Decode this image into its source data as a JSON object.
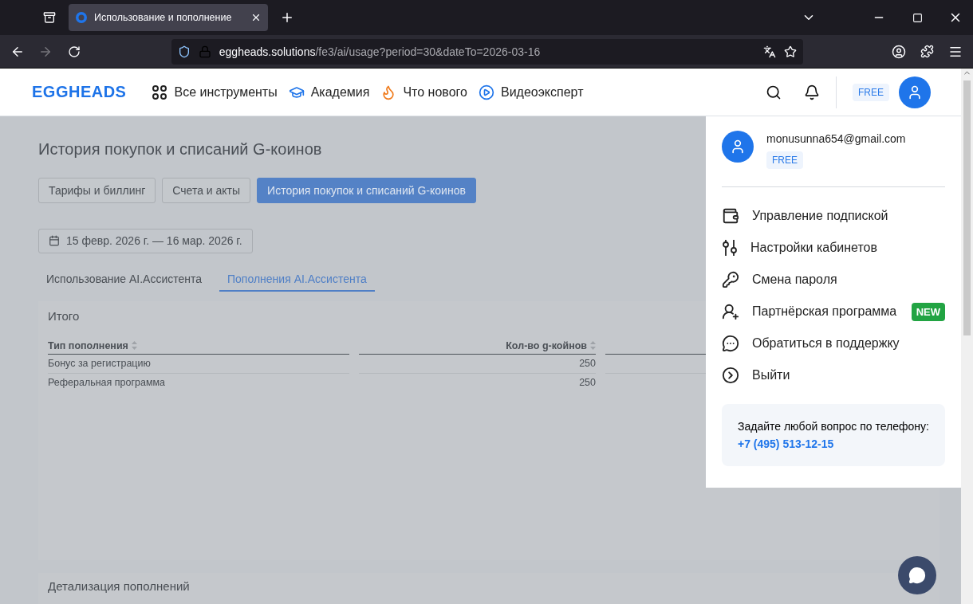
{
  "browser": {
    "tab_title": "Использование и пополнение",
    "url_host": "eggheads.solutions",
    "url_path": "/fe3/ai/usage?period=30&dateTo=2026-03-16"
  },
  "header": {
    "logo": "EGGHEADS",
    "nav": [
      {
        "label": "Все инструменты"
      },
      {
        "label": "Академия"
      },
      {
        "label": "Что нового"
      },
      {
        "label": "Видеоэксперт"
      }
    ],
    "plan_badge": "FREE"
  },
  "page": {
    "title": "История покупок и списаний G-коинов",
    "section_tabs": [
      {
        "label": "Тарифы и биллинг",
        "selected": false
      },
      {
        "label": "Счета и акты",
        "selected": false
      },
      {
        "label": "История покупок и списаний G-коинов",
        "selected": true
      }
    ],
    "date_range": "15 февр. 2026 г. — 16 мар. 2026 г.",
    "subtabs": [
      {
        "label": "Использование AI.Ассистента",
        "selected": false
      },
      {
        "label": "Пополнения AI.Ассистента",
        "selected": true
      }
    ],
    "summary": {
      "title": "Итого",
      "columns": [
        {
          "label": "Тип пополнения"
        },
        {
          "label": "Кол-во g-койнов"
        }
      ],
      "rows": [
        [
          "Бонус за регистрацию",
          "250"
        ],
        [
          "Реферальная программа",
          "250"
        ]
      ]
    },
    "details_title": "Детализация пополнений"
  },
  "menu": {
    "email": "monusunna654@gmail.com",
    "plan": "FREE",
    "items": [
      {
        "label": "Управление подпиской"
      },
      {
        "label": "Настройки кабинетов"
      },
      {
        "label": "Смена пароля"
      },
      {
        "label": "Партнёрская программа",
        "badge": "NEW"
      },
      {
        "label": "Обратиться в поддержку"
      },
      {
        "label": "Выйти"
      }
    ],
    "contact": {
      "text": "Задайте любой вопрос по телефону:",
      "phone": "+7 (495) 513-12-15"
    }
  }
}
